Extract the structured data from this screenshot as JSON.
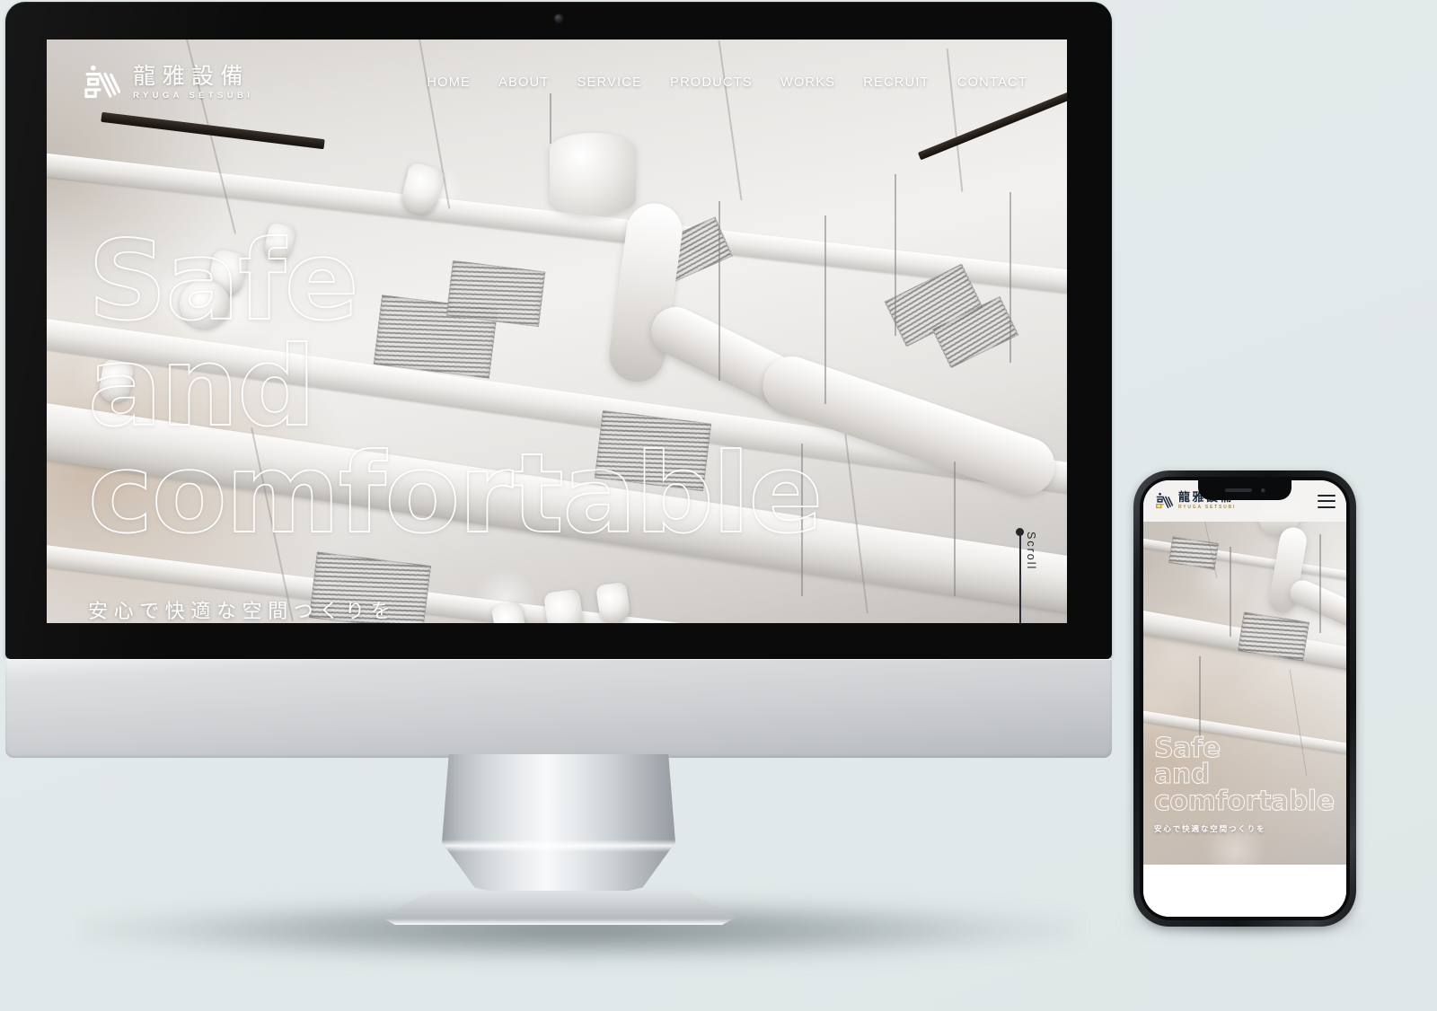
{
  "page": {
    "background_color": "#e3e9ea"
  },
  "site": {
    "logo": {
      "mark": "ryuga-dragon-mark-icon",
      "name_jp": "龍雅設備",
      "name_en": "RYUGA SETSUBI",
      "accent_color": "#c9a227",
      "text_color": "#1d2a3d"
    },
    "nav": {
      "items": [
        {
          "label": "HOME"
        },
        {
          "label": "ABOUT"
        },
        {
          "label": "SERVICE"
        },
        {
          "label": "PRODUCTS"
        },
        {
          "label": "WORKS"
        },
        {
          "label": "RECRUIT"
        },
        {
          "label": "CONTACT"
        }
      ]
    },
    "hero": {
      "headline_lines": [
        "Safe",
        "and",
        "comfortable"
      ],
      "subtitle": "安心で快適な空間つくりを",
      "text_color": "#ffffff",
      "image_description": "industrial ceiling with white HVAC ducts, vents and track spotlights"
    },
    "scroll_indicator": {
      "label": "Scroll",
      "color": "#23272b"
    }
  },
  "mobile": {
    "header": {
      "logo_jp": "龍雅設備",
      "logo_en": "RYUGA SETSUBI",
      "menu_icon": "hamburger-menu-icon",
      "background_color": "#f5f4f2"
    },
    "hero": {
      "headline_lines": [
        "Safe",
        "and",
        "comfortable"
      ],
      "subtitle": "安心で快適な空間つくりを"
    }
  },
  "devices": {
    "desktop": "imac-mockup",
    "handheld": "iphone-mockup"
  }
}
